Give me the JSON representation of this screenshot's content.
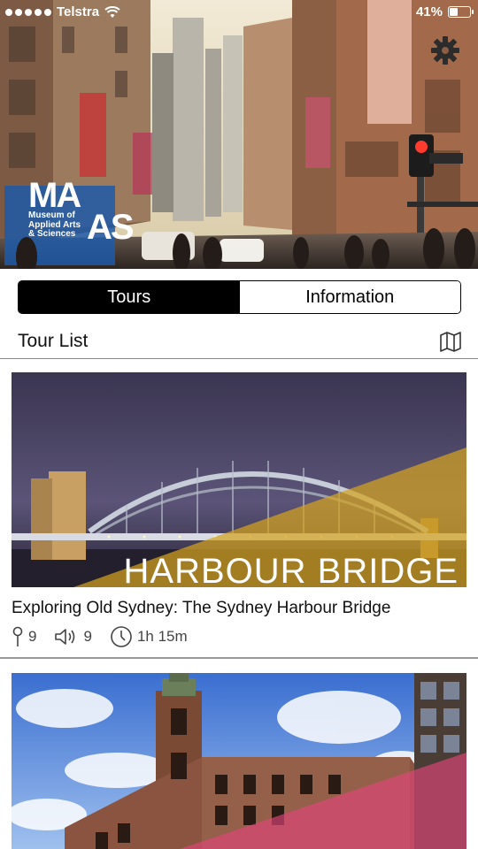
{
  "status_bar": {
    "carrier": "Telstra",
    "battery": "41%",
    "battery_level": 0.41
  },
  "hero": {
    "logo_line1": "MA",
    "logo_line2": "AS",
    "logo_subtitle": "Museum of Applied Arts & Sciences",
    "settings_icon": "gear-icon"
  },
  "segmented": {
    "tabs": [
      {
        "label": "Tours",
        "active": true
      },
      {
        "label": "Information",
        "active": false
      }
    ]
  },
  "tour_list": {
    "title": "Tour List",
    "map_icon": "map-icon",
    "tours": [
      {
        "image_caption": "HARBOUR BRIDGE",
        "title": "Exploring Old Sydney: The Sydney Harbour Bridge",
        "stops": "9",
        "audio": "9",
        "duration": "1h 15m"
      },
      {
        "image_caption": "",
        "title": "",
        "stops": "",
        "audio": "",
        "duration": ""
      }
    ]
  },
  "colors": {
    "accent_gold": "#d4a21e",
    "accent_pink": "#e0457a",
    "segment_active_bg": "#000000"
  }
}
